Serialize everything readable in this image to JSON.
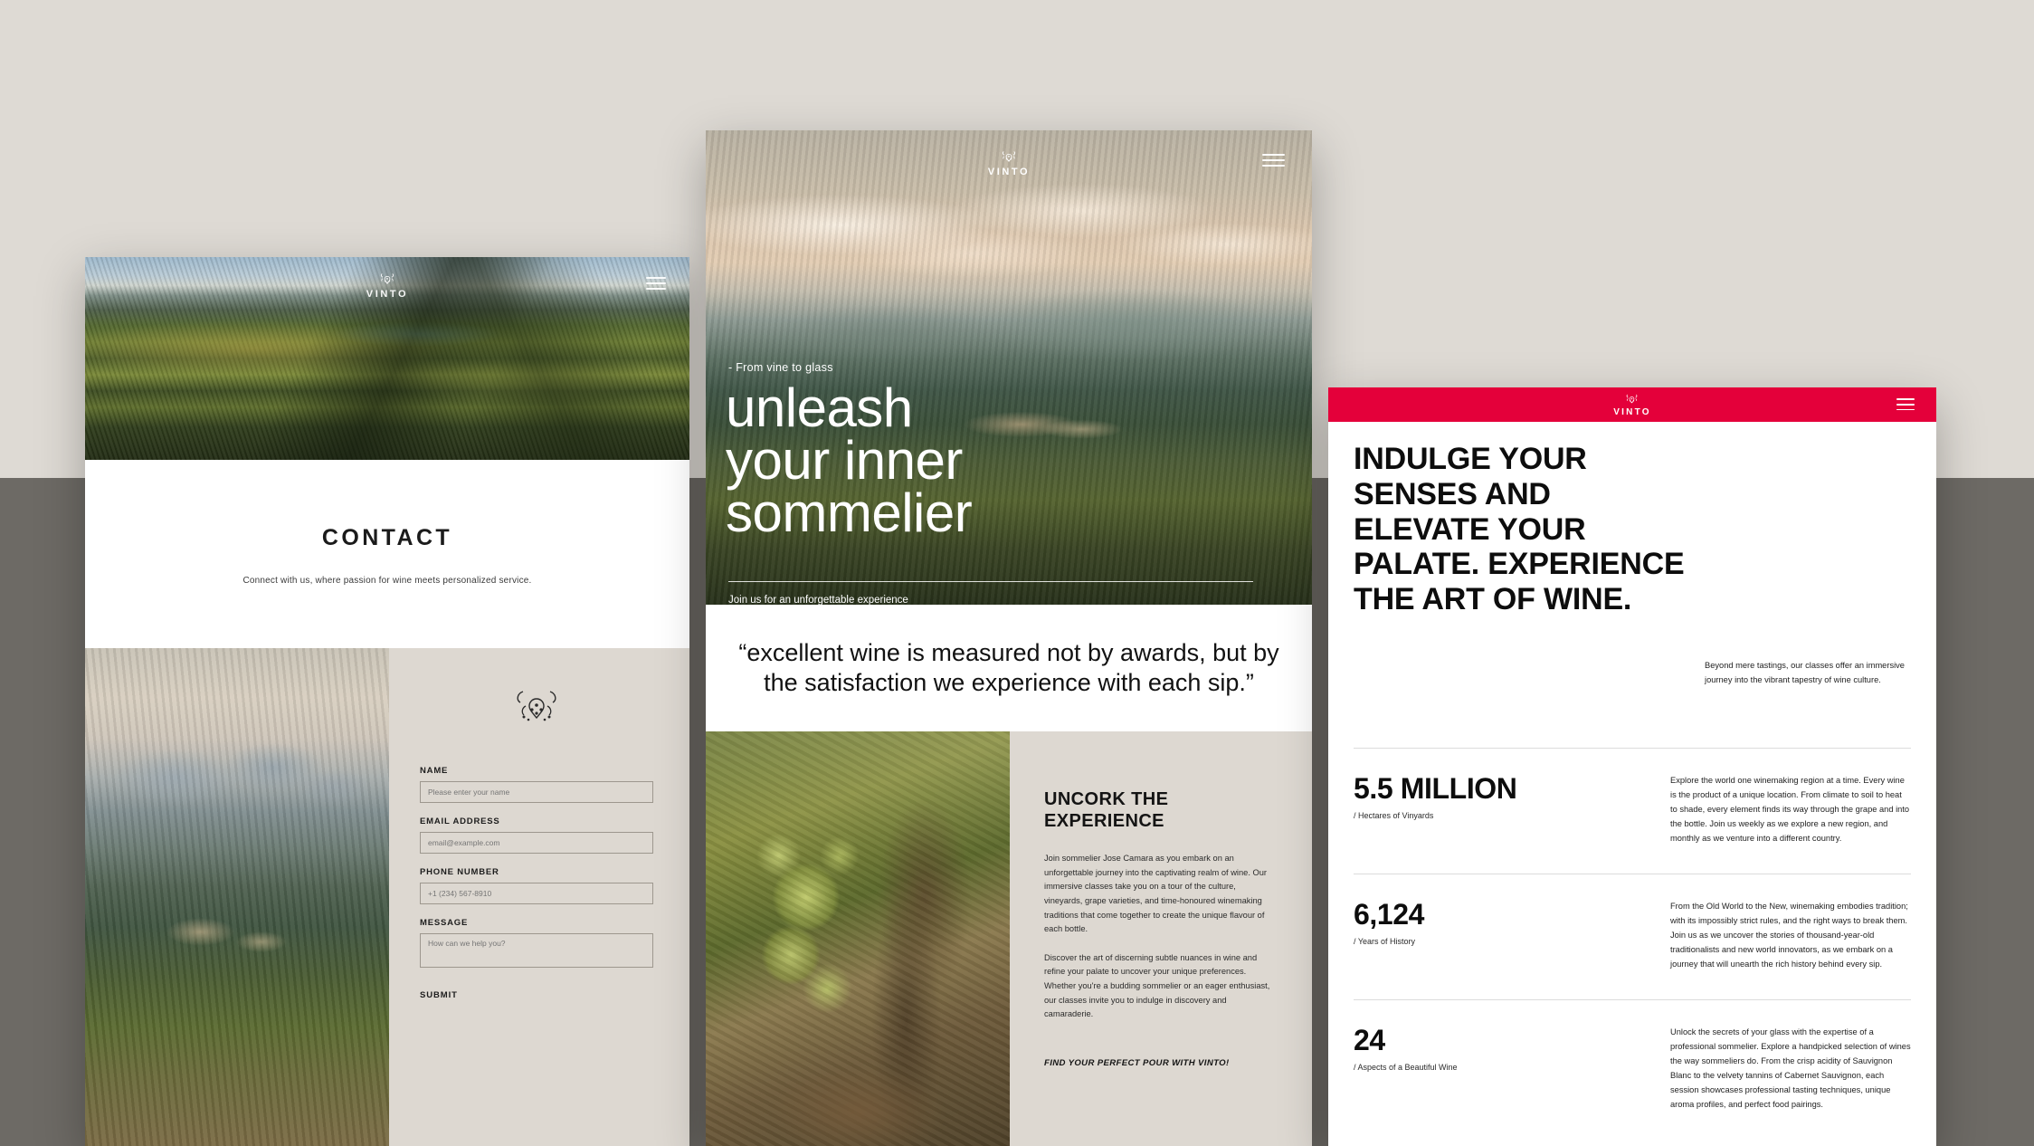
{
  "brand": {
    "name": "VINTO",
    "logo_icon": "vine-crest-icon",
    "menu_icon": "hamburger-menu-icon"
  },
  "colors": {
    "accent_red": "#E4003A",
    "panel_beige": "#DDD8D1",
    "page_top": "#DEDAD4",
    "page_bottom": "#6D6A65"
  },
  "left_panel": {
    "hero_image": "aerial-vineyard-photo",
    "contact": {
      "title": "CONTACT",
      "subtitle": "Connect with us, where passion for wine meets personalized service."
    },
    "side_image": "mountains-village-photo",
    "ornament_icon": "ornamental-crest-icon",
    "form": {
      "fields": [
        {
          "label": "NAME",
          "placeholder": "Please enter your name",
          "value": "",
          "name": "name-field"
        },
        {
          "label": "EMAIL ADDRESS",
          "placeholder": "email@example.com",
          "value": "",
          "name": "email-field"
        },
        {
          "label": "PHONE NUMBER",
          "placeholder": "+1 (234) 567-8910",
          "value": "",
          "name": "phone-field"
        },
        {
          "label": "MESSAGE",
          "placeholder": "How can we help you?",
          "value": "",
          "name": "message-field"
        }
      ],
      "submit_label": "SUBMIT"
    }
  },
  "mid_panel": {
    "hero_image": "tuscan-hills-village-photo",
    "eyebrow": "- From vine to glass",
    "title_line1": "unleash",
    "title_line2": "your inner",
    "title_line3": "sommelier",
    "tagline": "Join us for an unforgettable experience",
    "quote": "“excellent wine is measured not by awards, but by the satisfaction we experience with each sip.”",
    "lower_image": "grapes-on-vine-photo",
    "section_heading": "UNCORK THE EXPERIENCE",
    "paragraph1": "Join sommelier Jose Camara as you embark on an unforgettable journey into the captivating realm of wine. Our immersive classes take you on a tour of the culture, vineyards, grape varieties, and time-honoured winemaking traditions that come together to create the unique flavour of each bottle.",
    "paragraph2": "Discover the art of discerning subtle nuances in wine and refine your palate to uncover your unique preferences. Whether you're a budding sommelier or an eager enthusiast, our classes invite you to indulge in discovery and camaraderie.",
    "cta": "FIND YOUR PERFECT POUR WITH VINTO!"
  },
  "right_panel": {
    "heading": "INDULGE YOUR SENSES AND ELEVATE YOUR PALATE. EXPERIENCE THE ART OF WINE.",
    "intro": "Beyond mere tastings, our classes offer an immersive journey into the vibrant tapestry of wine culture.",
    "stats": [
      {
        "number": "5.5 MILLION",
        "caption": "/ Hectares of Vinyards",
        "body": "Explore the world one winemaking region at a time. Every wine is the product of a unique location. From climate to soil to heat to shade, every element finds its way through the grape and into the bottle. Join us weekly as we explore a new region, and monthly as we venture into a different country."
      },
      {
        "number": "6,124",
        "caption": "/ Years of History",
        "body": "From the Old World to the New, winemaking embodies tradition; with its impossibly strict rules, and the right ways to break them. Join us as we uncover the stories of thousand-year-old traditionalists and new world innovators, as we embark on a journey that will unearth the rich history behind every sip."
      },
      {
        "number": "24",
        "caption": "/ Aspects of a Beautiful Wine",
        "body": "Unlock the secrets of your glass with the expertise of a professional sommelier. Explore a handpicked selection of wines the way sommeliers do. From the crisp acidity of Sauvignon Blanc to the velvety tannins of Cabernet Sauvignon, each session showcases professional tasting techniques, unique aroma profiles, and perfect food pairings."
      }
    ]
  }
}
